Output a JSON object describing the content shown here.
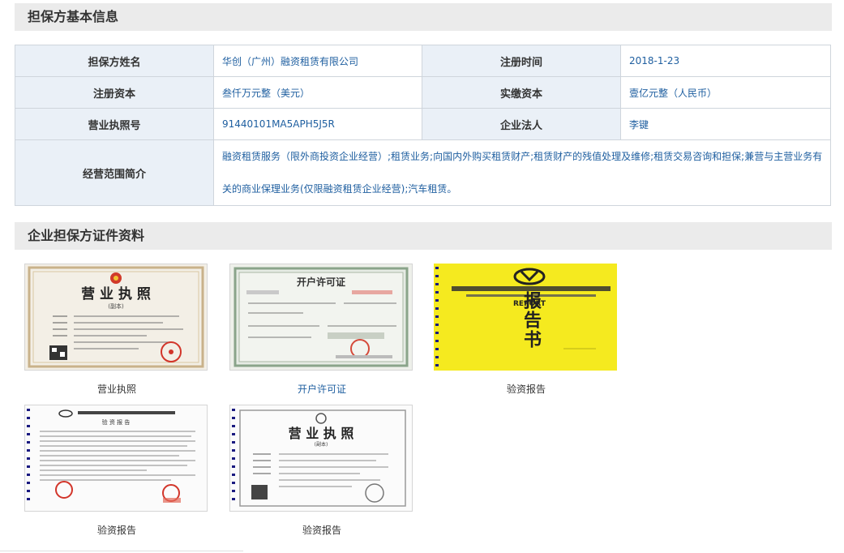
{
  "sections": {
    "basic_info_title": "担保方基本信息",
    "certificates_title": "企业担保方证件资料"
  },
  "info": {
    "name_label": "担保方姓名",
    "name_value": "华创（广州）融资租赁有限公司",
    "reg_time_label": "注册时间",
    "reg_time_value": "2018-1-23",
    "reg_capital_label": "注册资本",
    "reg_capital_value": "叁仟万元整（美元）",
    "paid_capital_label": "实缴资本",
    "paid_capital_value": "壹亿元整（人民币）",
    "license_no_label": "营业执照号",
    "license_no_value": "91440101MA5APH5J5R",
    "legal_person_label": "企业法人",
    "legal_person_value": "李键",
    "scope_label": "经营范围简介",
    "scope_value": "融资租赁服务（限外商投资企业经营）;租赁业务;向国内外购买租赁财产;租赁财产的残值处理及维修;租赁交易咨询和担保;兼营与主营业务有关的商业保理业务(仅限融资租赁企业经营);汽车租赁。"
  },
  "documents": [
    {
      "caption": "营业执照",
      "image_title": "营 业 执 照",
      "image_subtitle": "(副本)"
    },
    {
      "caption": "开户许可证",
      "image_title": "开户许可证"
    },
    {
      "caption": "验资报告",
      "image_title": "报告书",
      "image_heading": "REPORT"
    },
    {
      "caption": "验资报告",
      "image_title": "验 资 报 告"
    },
    {
      "caption": "验资报告",
      "image_title": "营 业 执 照",
      "image_subtitle": "(副本)"
    }
  ],
  "colors": {
    "header_bg": "#ebebeb",
    "label_bg": "#eaf0f7",
    "value_text": "#1f5fa0",
    "border": "#cfd5dc",
    "report_yellow": "#f5ea1f"
  }
}
